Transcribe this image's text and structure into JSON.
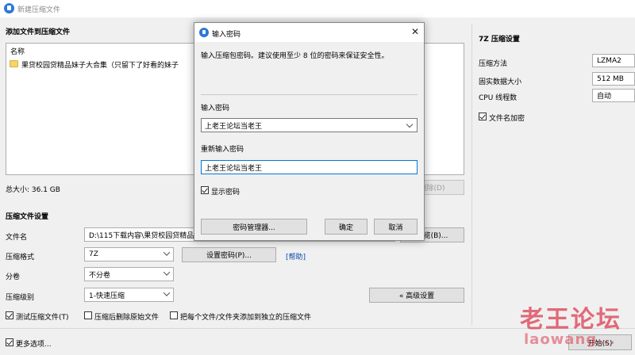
{
  "window": {
    "title": "新建压缩文件"
  },
  "files_section": {
    "title": "添加文件到压缩文件",
    "column_name": "名称",
    "items": [
      {
        "name": "果贷校园贷精品妹子大合集（只留下了好看的妹子"
      }
    ],
    "total_size": "总大小: 36.1 GB",
    "delete_button": "删除(D)"
  },
  "settings_section": {
    "title": "压缩文件设置",
    "filename_label": "文件名",
    "filename_value": "D:\\115下载内容\\果贷校园贷精品",
    "browse_button": "浏览(B)...",
    "format_label": "压缩格式",
    "format_value": "7Z",
    "set_password_button": "设置密码(P)...",
    "help_link": "[帮助]",
    "split_label": "分卷",
    "split_value": "不分卷",
    "level_label": "压缩级别",
    "level_value": "1-快速压缩",
    "advanced_button": "« 高级设置"
  },
  "options": {
    "test_archive": {
      "label": "测试压缩文件(T)",
      "checked": true
    },
    "delete_after": {
      "label": "压缩后删除原始文件",
      "checked": false
    },
    "separate_archives": {
      "label": "把每个文件/文件夹添加到独立的压缩文件",
      "checked": false
    },
    "more_options": {
      "label": "更多选项...",
      "checked": true
    }
  },
  "footer": {
    "start_button": "开始(S)"
  },
  "right_panel": {
    "title": "7Z 压缩设置",
    "method_label": "压缩方法",
    "method_value": "LZMA2",
    "solid_label": "固实数据大小",
    "solid_value": "512 MB",
    "threads_label": "CPU 线程数",
    "threads_value": "自动",
    "encrypt_names": {
      "label": "文件名加密",
      "checked": true
    }
  },
  "dialog": {
    "title": "输入密码",
    "close_glyph": "✕",
    "description": "输入压缩包密码。建议使用至少 8 位的密码来保证安全性。",
    "password_label": "输入密码",
    "password_value": "上老王论坛当老王",
    "confirm_label": "重新输入密码",
    "confirm_value": "上老王论坛当老王",
    "show_password": {
      "label": "显示密码",
      "checked": true
    },
    "manager_button": "密码管理器...",
    "ok_button": "确定",
    "cancel_button": "取消"
  },
  "watermark": {
    "text": "老王论坛",
    "url": "laowang..."
  },
  "icons": [
    "app-icon",
    "folder-icon",
    "chevron-down-icon",
    "close-icon",
    "checkbox-icon"
  ],
  "colors": {
    "accent": "#0078d7",
    "link": "#0645ad",
    "watermark": "#dc3c50"
  }
}
